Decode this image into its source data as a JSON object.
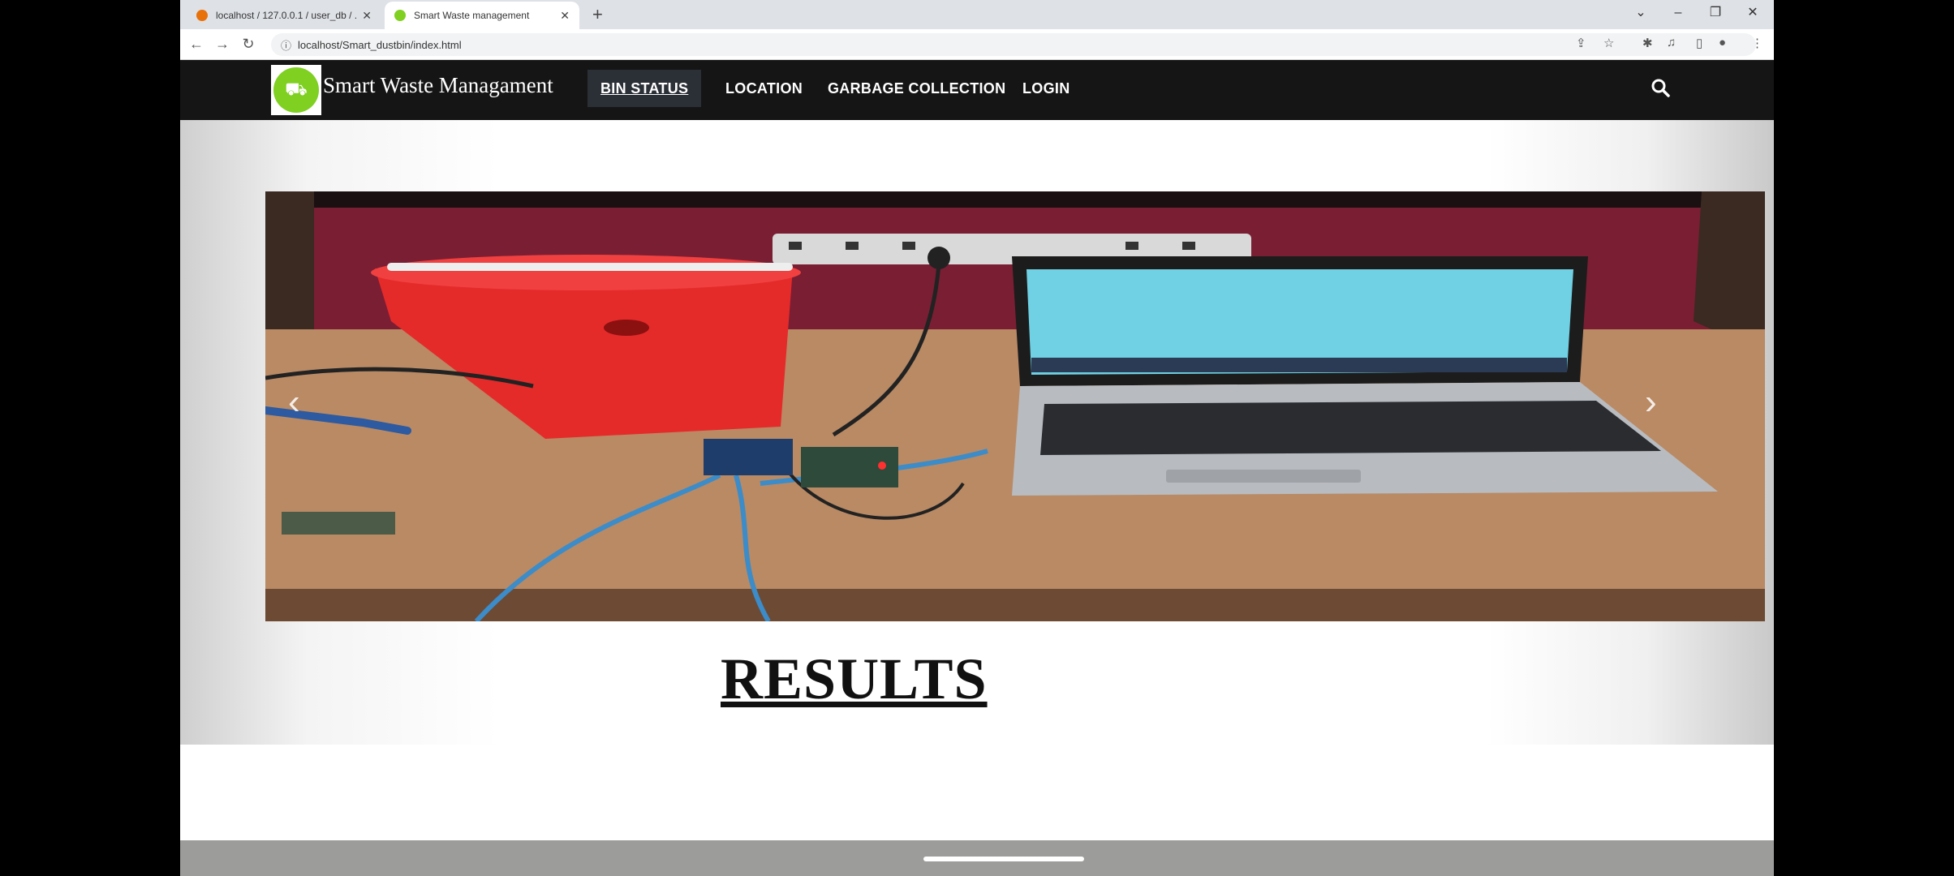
{
  "browser": {
    "tabs": [
      {
        "title": "localhost / 127.0.0.1 / user_db / ...",
        "active": false,
        "favicon_color": "#e8710a"
      },
      {
        "title": "Smart Waste management",
        "active": true,
        "favicon_color": "#7fd021"
      }
    ],
    "address": "localhost/Smart_dustbin/index.html",
    "toolbar_icons": [
      "share-icon",
      "star-icon",
      "extensions-icon",
      "media-icon",
      "sidepanel-icon",
      "profile-icon",
      "menu-icon"
    ]
  },
  "site": {
    "brand": "Smart Waste Managament",
    "nav": [
      "BIN STATUS",
      "LOCATION",
      "GARBAGE COLLECTION",
      "LOGIN"
    ],
    "active_nav": "BIN STATUS",
    "logo_color": "#7fd021",
    "nav_bg": "#151515"
  },
  "carousel": {
    "prev": "‹",
    "next": "›"
  },
  "main": {
    "heading": "RESULTS"
  }
}
